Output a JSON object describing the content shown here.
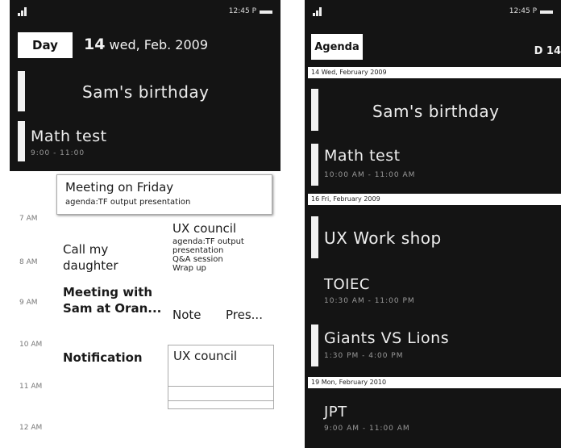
{
  "left": {
    "status": {
      "time": "12:45 P"
    },
    "view_tab": "Day",
    "date_num": "14",
    "date_text": "wed, Feb. 2009",
    "events": [
      {
        "title": "Sam's birthday"
      },
      {
        "title": "Math test",
        "time": "9:00 - 11:00"
      }
    ],
    "hours": [
      "7 AM",
      "8 AM",
      "9 AM",
      "10 AM",
      "11 AM",
      "12 AM"
    ],
    "cards": {
      "meeting_friday": {
        "title": "Meeting on Friday",
        "agenda": "agenda:TF output presentation"
      },
      "call_daughter": {
        "line1": "Call my",
        "line2": "daughter"
      },
      "meeting_sam": {
        "line1": "Meeting with",
        "line2": "Sam at Oran..."
      },
      "ux_council": {
        "title": "UX council",
        "agenda": "agenda:TF output presentation",
        "qa": "Q&A session",
        "wrap": "Wrap up"
      },
      "note": "Note",
      "pres": "Pres...",
      "notification": "Notification",
      "ux_council_box": "UX council"
    }
  },
  "right": {
    "status": {
      "time": "12:45 P"
    },
    "view_tab": "Agenda",
    "corner_date": "D 14",
    "sections": [
      {
        "header": "14 Wed, February 2009"
      },
      {
        "header": "16 Fri, February 2009"
      },
      {
        "header": "19 Mon, February 2010"
      }
    ],
    "events": {
      "sams_birthday": "Sam's birthday",
      "math_test": {
        "title": "Math test",
        "time": "10:00 AM - 11:00 AM"
      },
      "ux_workshop": "UX Work shop",
      "toiec": {
        "title": "TOIEC",
        "time": "10:30 AM - 11:00 PM"
      },
      "giants": {
        "title": "Giants VS Lions",
        "time": "1:30 PM - 4:00 PM"
      },
      "jpt": {
        "title": "JPT",
        "time": "9:00 AM - 11:00 AM"
      }
    }
  }
}
